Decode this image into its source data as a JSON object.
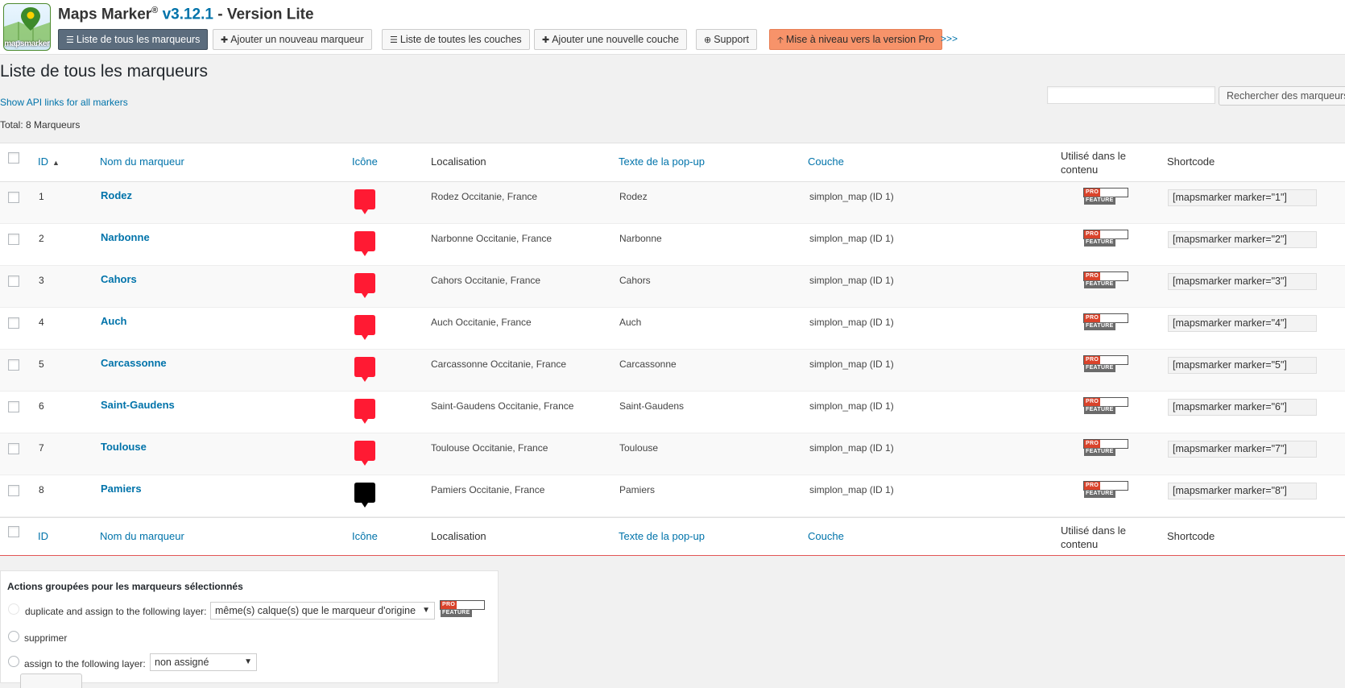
{
  "header": {
    "logo_text": "mapsmarker",
    "title_name": "Maps Marker",
    "title_reg": "®",
    "title_version": "v3.12.1",
    "title_edition": "- Version Lite",
    "nav": [
      {
        "label": "Liste de tous les marqueurs",
        "icon": "list-icon"
      },
      {
        "label": "Ajouter un nouveau marqueur",
        "icon": "plus-icon"
      },
      {
        "label": "Liste de toutes les couches",
        "icon": "list-icon"
      },
      {
        "label": "Ajouter une nouvelle couche",
        "icon": "plus-icon"
      },
      {
        "label": "Support",
        "icon": "plus-circle-icon"
      },
      {
        "label": "Mise à niveau vers la version Pro",
        "icon": "arrow-up-icon"
      }
    ],
    "more_label": ">>>"
  },
  "page": {
    "title": "Liste de tous les marqueurs",
    "api_link": "Show API links for all markers",
    "total": "Total: 8 Marqueurs",
    "search_button": "Rechercher des marqueurs",
    "search_placeholder": ""
  },
  "table": {
    "columns": {
      "id": "ID",
      "name": "Nom du marqueur",
      "icon": "Icône",
      "location": "Localisation",
      "popup": "Texte de la pop-up",
      "layer": "Couche",
      "used_line1": "Utilisé dans le",
      "used_line2": "contenu",
      "shortcode": "Shortcode"
    },
    "pro_badge": {
      "left": "PRO",
      "right": "FEATURE"
    },
    "rows": [
      {
        "id": "1",
        "name": "Rodez",
        "icon_color": "#ff1a33",
        "location": "Rodez Occitanie, France",
        "popup": "Rodez",
        "layer": "simplon_map (ID 1)",
        "shortcode": "[mapsmarker marker=\"1\"]"
      },
      {
        "id": "2",
        "name": "Narbonne",
        "icon_color": "#ff1a33",
        "location": "Narbonne Occitanie, France",
        "popup": "Narbonne",
        "layer": "simplon_map (ID 1)",
        "shortcode": "[mapsmarker marker=\"2\"]"
      },
      {
        "id": "3",
        "name": "Cahors",
        "icon_color": "#ff1a33",
        "location": "Cahors Occitanie, France",
        "popup": "Cahors",
        "layer": "simplon_map (ID 1)",
        "shortcode": "[mapsmarker marker=\"3\"]"
      },
      {
        "id": "4",
        "name": "Auch",
        "icon_color": "#ff1a33",
        "location": "Auch Occitanie, France",
        "popup": "Auch",
        "layer": "simplon_map (ID 1)",
        "shortcode": "[mapsmarker marker=\"4\"]"
      },
      {
        "id": "5",
        "name": "Carcassonne",
        "icon_color": "#ff1a33",
        "location": "Carcassonne Occitanie, France",
        "popup": "Carcassonne",
        "layer": "simplon_map (ID 1)",
        "shortcode": "[mapsmarker marker=\"5\"]"
      },
      {
        "id": "6",
        "name": "Saint-Gaudens",
        "icon_color": "#ff1a33",
        "location": "Saint-Gaudens Occitanie, France",
        "popup": "Saint-Gaudens",
        "layer": "simplon_map (ID 1)",
        "shortcode": "[mapsmarker marker=\"6\"]"
      },
      {
        "id": "7",
        "name": "Toulouse",
        "icon_color": "#ff1a33",
        "location": "Toulouse Occitanie, France",
        "popup": "Toulouse",
        "layer": "simplon_map (ID 1)",
        "shortcode": "[mapsmarker marker=\"7\"]"
      },
      {
        "id": "8",
        "name": "Pamiers",
        "icon_color": "#000000",
        "location": "Pamiers Occitanie, France",
        "popup": "Pamiers",
        "layer": "simplon_map (ID 1)",
        "shortcode": "[mapsmarker marker=\"8\"]"
      }
    ]
  },
  "bulk": {
    "title": "Actions groupées pour les marqueurs sélectionnés",
    "duplicate_label": "duplicate and assign to the following layer:",
    "duplicate_select": "même(s) calque(s) que le marqueur d'origine",
    "delete_label": "supprimer",
    "assign_label": "assign to the following layer:",
    "assign_select": "non assigné"
  },
  "colors": {
    "accent": "#0073aa",
    "active_nav": "#5b6c7d",
    "upgrade": "#f7936a",
    "marker_red": "#ff1a33"
  }
}
